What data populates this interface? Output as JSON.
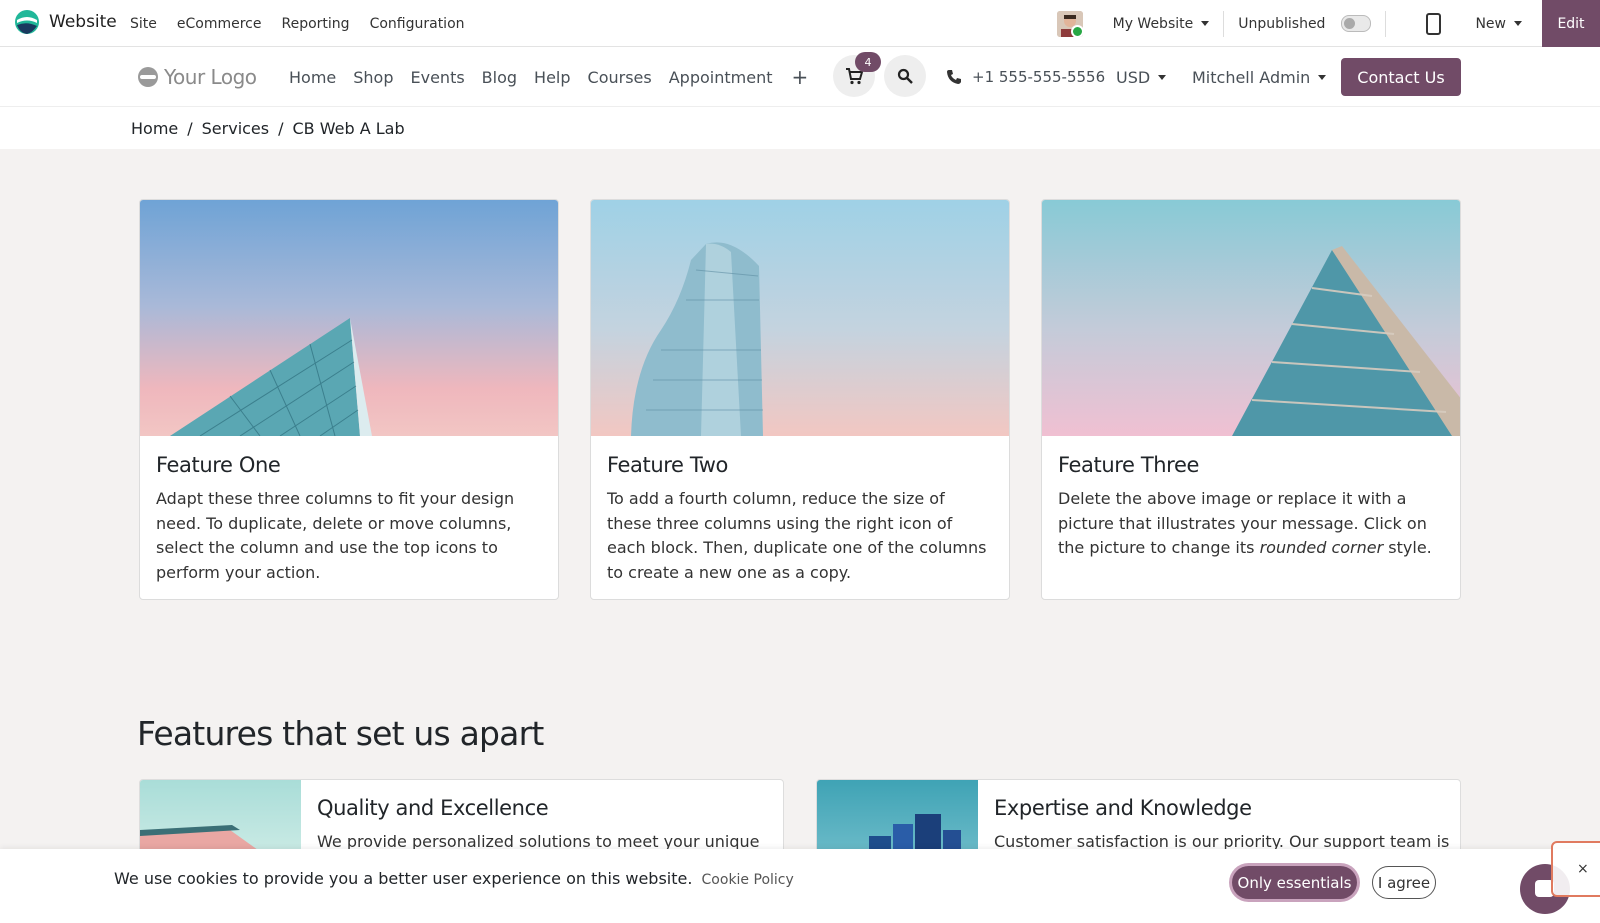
{
  "topbar": {
    "app_title": "Website",
    "menu": [
      "Site",
      "eCommerce",
      "Reporting",
      "Configuration"
    ],
    "website_selector": "My Website",
    "publish_status": "Unpublished",
    "new_label": "New",
    "edit_label": "Edit"
  },
  "site_nav": {
    "logo_text": "Your Logo",
    "links": [
      "Home",
      "Shop",
      "Events",
      "Blog",
      "Help",
      "Courses",
      "Appointment"
    ],
    "add_icon": "+",
    "cart_count": "4",
    "phone": "+1 555-555-5556",
    "currency": "USD",
    "user": "Mitchell Admin",
    "contact_label": "Contact Us"
  },
  "breadcrumb": {
    "items": [
      "Home",
      "Services",
      "CB Web A Lab"
    ],
    "separator": "/"
  },
  "cards": [
    {
      "title": "Feature One",
      "text": "Adapt these three columns to fit your design need. To duplicate, delete or move columns, select the column and use the top icons to perform your action."
    },
    {
      "title": "Feature Two",
      "text": "To add a fourth column, reduce the size of these three columns using the right icon of each block. Then, duplicate one of the columns to create a new one as a copy."
    },
    {
      "title": "Feature Three",
      "text_before": "Delete the above image or replace it with a picture that illustrates your message. Click on the picture to change its ",
      "text_em": "rounded corner",
      "text_after": " style."
    }
  ],
  "features_section": {
    "title": "Features that set us apart",
    "items": [
      {
        "title": "Quality and Excellence",
        "text": "We provide personalized solutions to meet your unique"
      },
      {
        "title": "Expertise and Knowledge",
        "text": "Customer satisfaction is our priority. Our support team is"
      }
    ]
  },
  "cookie_bar": {
    "text": "We use cookies to provide you a better user experience on this website.",
    "policy_link": "Cookie Policy",
    "essentials_label": "Only essentials",
    "agree_label": "I agree",
    "close_glyph": "×"
  },
  "colors": {
    "brand": "#714b67",
    "page_background": "#f4f2f1"
  },
  "icons": [
    "website-app-icon",
    "user-avatar",
    "caret-down-icon",
    "mobile-preview-icon",
    "plus-icon",
    "cart-icon",
    "search-icon",
    "phone-icon",
    "chat-icon",
    "close-icon"
  ]
}
